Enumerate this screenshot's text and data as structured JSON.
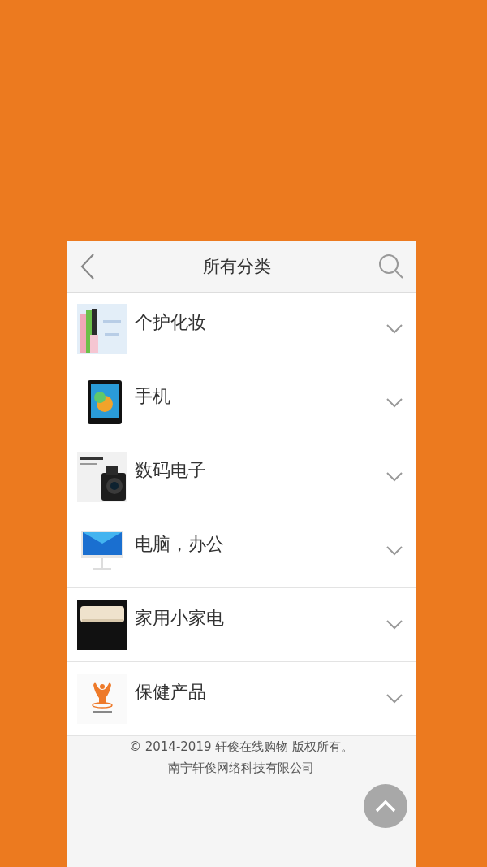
{
  "header": {
    "title": "所有分类"
  },
  "categories": [
    {
      "label": "个护化妆",
      "expanded": false
    },
    {
      "label": "手机",
      "expanded": false
    },
    {
      "label": "数码电子",
      "expanded": false
    },
    {
      "label": "电脑，办公",
      "expanded": false
    },
    {
      "label": "家用小家电",
      "expanded": false
    },
    {
      "label": "保健产品",
      "expanded": false
    }
  ],
  "footer": {
    "copyright": "© 2014-2019 轩俊在线购物 版权所有。",
    "company": "南宁轩俊网络科技有限公司"
  }
}
